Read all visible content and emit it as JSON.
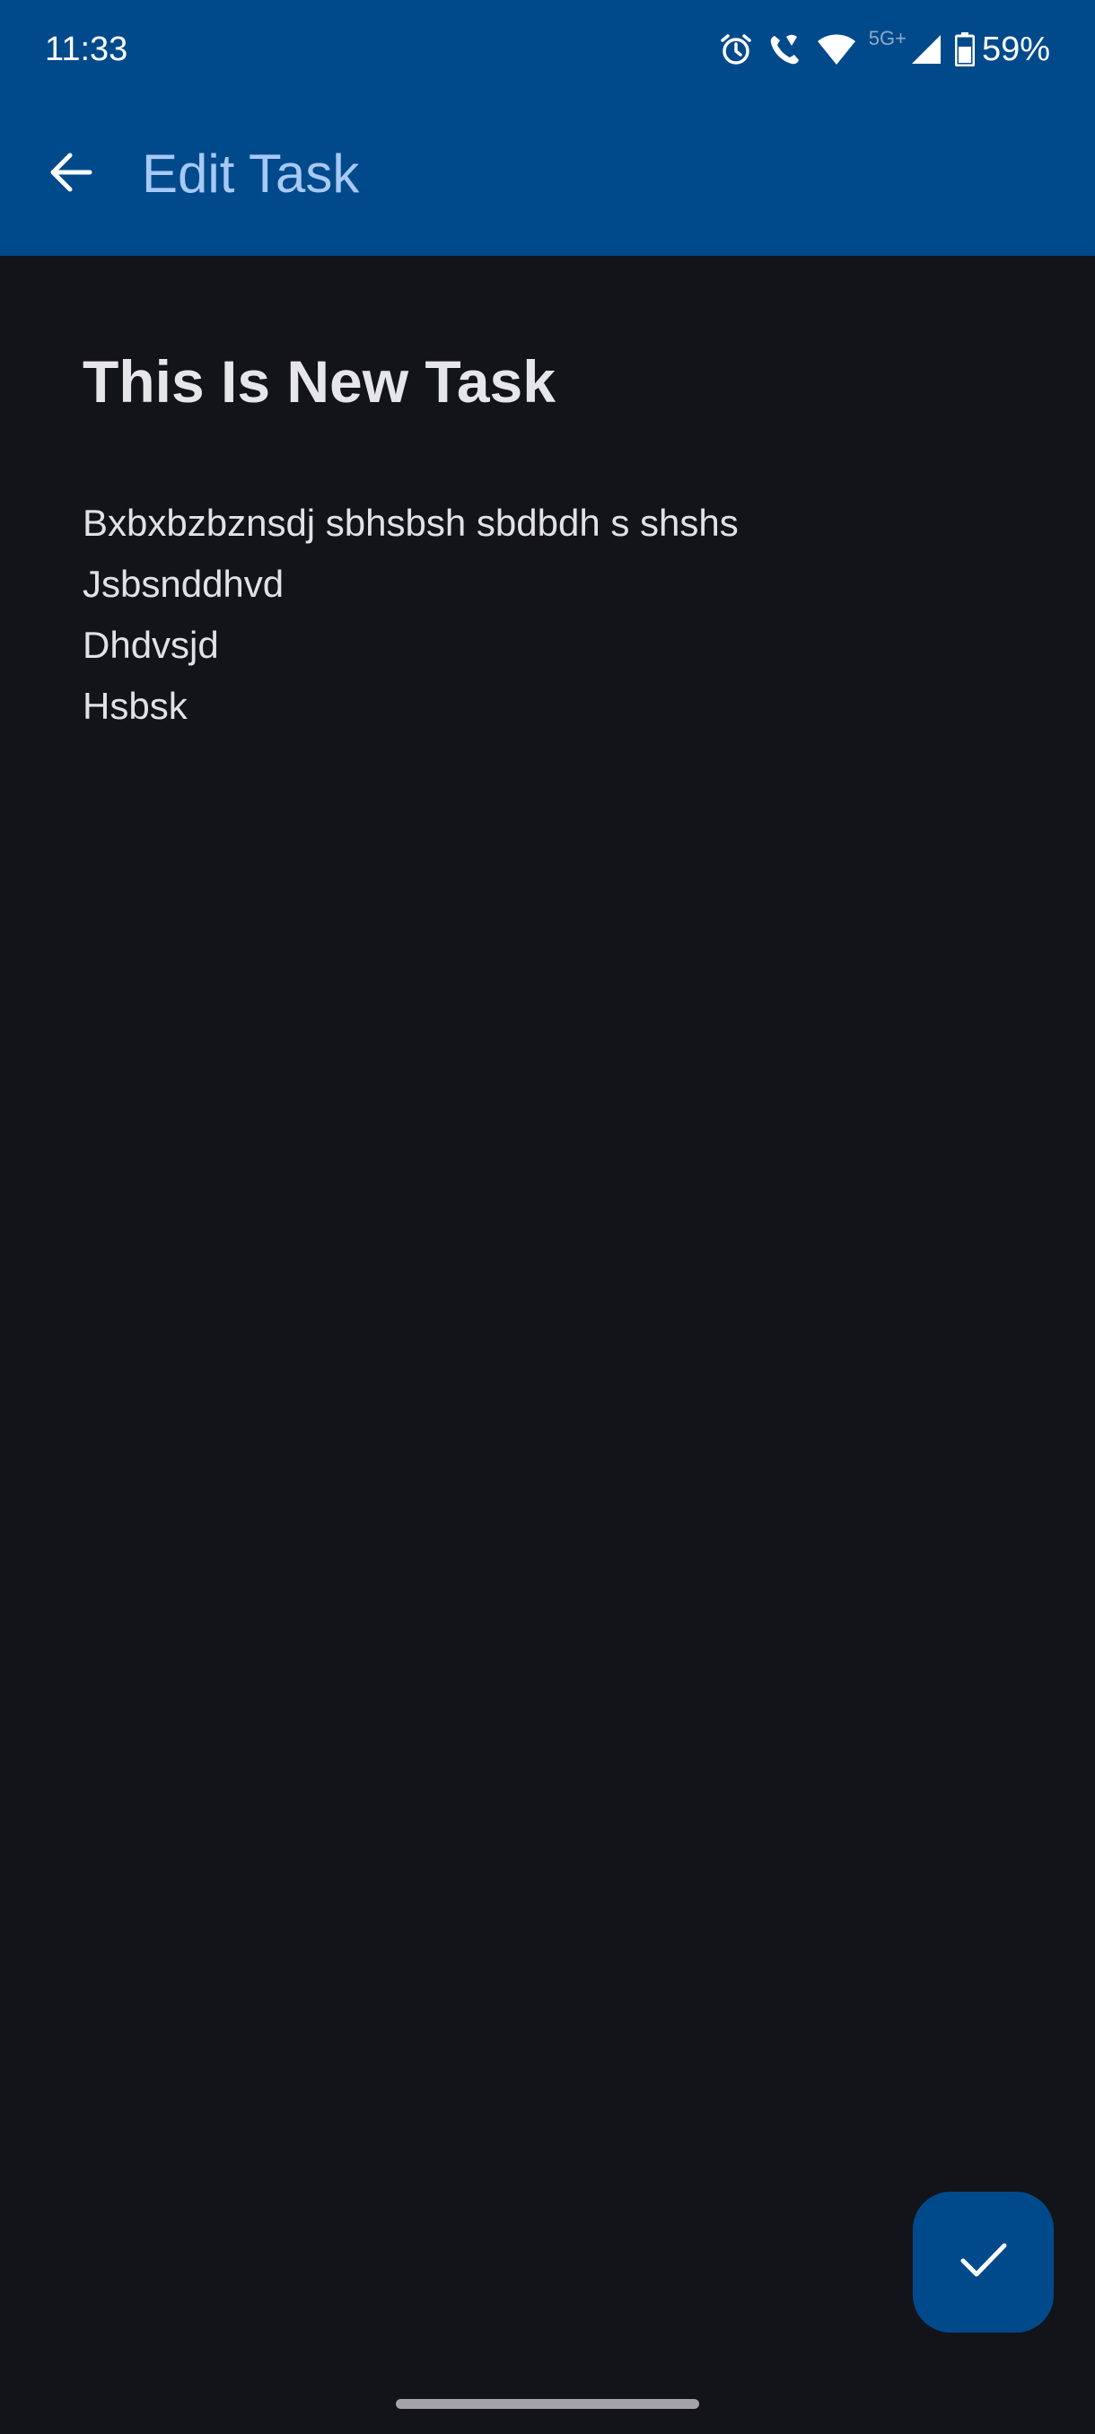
{
  "status_bar": {
    "time": "11:33",
    "network_label": "5G+",
    "battery_percent": "59%",
    "icons": [
      "alarm-icon",
      "wifi-call-icon",
      "wifi-icon",
      "signal-icon",
      "battery-icon"
    ]
  },
  "app_bar": {
    "title": "Edit Task",
    "back_icon": "arrow-back-icon",
    "background_color": "#004a8c",
    "title_color": "#a8c8f5"
  },
  "task": {
    "title": "This Is New Task",
    "body_lines": [
      "Bxbxbzbznsdj sbhsbsh sbdbdh s shshs",
      "Jsbsnddhvd",
      "Dhdvsjd",
      "Hsbsk"
    ]
  },
  "fab": {
    "icon": "check-icon",
    "color": "#004a8c"
  },
  "theme": {
    "background": "#131419"
  }
}
